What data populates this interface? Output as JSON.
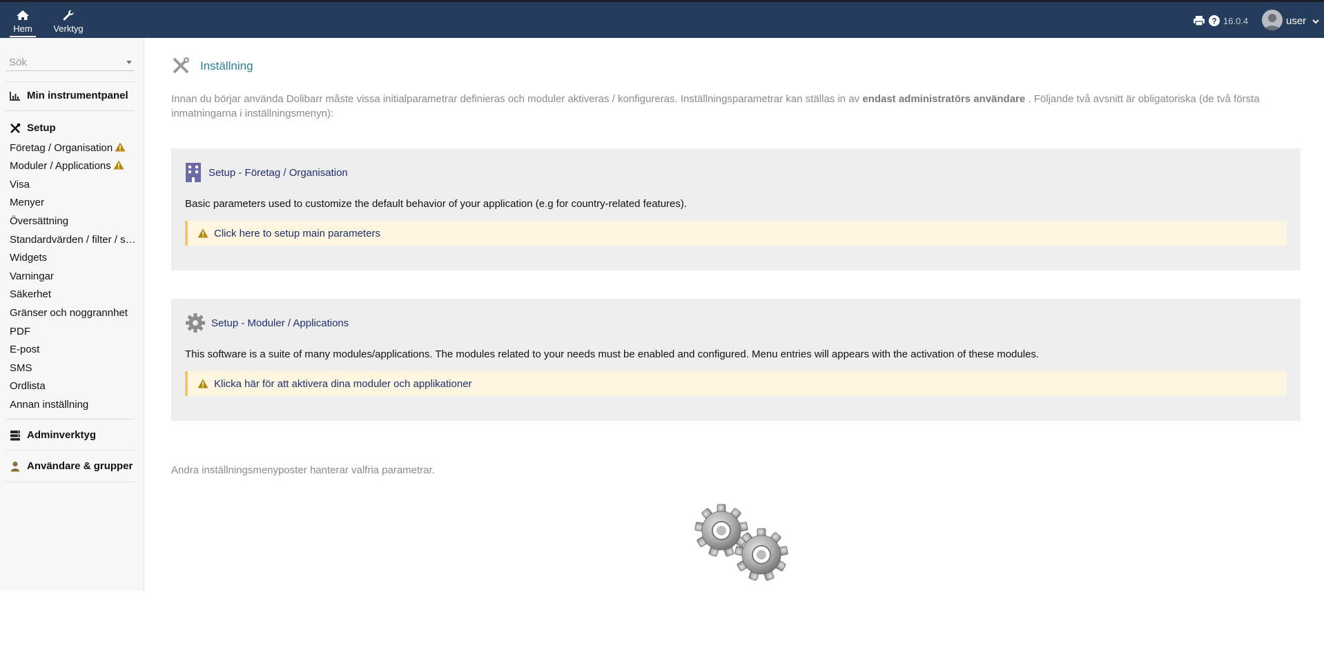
{
  "topbar": {
    "menu": [
      {
        "label": "Hem",
        "icon": "home-icon",
        "active": true
      },
      {
        "label": "Verktyg",
        "icon": "wrench-icon",
        "active": false
      }
    ],
    "version": "16.0.4",
    "user": "user",
    "background_color": "#263c5c"
  },
  "sidebar": {
    "search_placeholder": "Sök",
    "dashboard_label": "Min instrumentpanel",
    "setup_label": "Setup",
    "setup_items": [
      {
        "label": "Företag / Organisation",
        "warning": true
      },
      {
        "label": "Moduler / Applications",
        "warning": true
      },
      {
        "label": "Visa"
      },
      {
        "label": "Menyer"
      },
      {
        "label": "Översättning"
      },
      {
        "label": "Standardvärden / filter / s…"
      },
      {
        "label": "Widgets"
      },
      {
        "label": "Varningar"
      },
      {
        "label": "Säkerhet"
      },
      {
        "label": "Gränser och noggrannhet"
      },
      {
        "label": "PDF"
      },
      {
        "label": "E-post"
      },
      {
        "label": "SMS"
      },
      {
        "label": "Ordlista"
      },
      {
        "label": "Annan inställning"
      }
    ],
    "admin_tools_label": "Adminverktyg",
    "users_groups_label": "Användare & grupper"
  },
  "main": {
    "title": "Inställning",
    "intro_part1": "Innan du börjar använda Dolibarr måste vissa initialparametrar definieras och moduler aktiveras / konfigureras. Inställningsparametrar kan ställas in av",
    "intro_bold": "endast administratörs användare",
    "intro_part2": ". Följande två avsnitt är obligatoriska (de två första inmatningarna i inställningsmenyn):",
    "box_company": {
      "title": "Setup - Företag / Organisation",
      "description": "Basic parameters used to customize the default behavior of your application (e.g for country-related features).",
      "warning_link": "Click here to setup main parameters"
    },
    "box_modules": {
      "title": "Setup - Moduler / Applications",
      "description": "This software is a suite of many modules/applications. The modules related to your needs must be enabled and configured. Menu entries will appears with the activation of these modules.",
      "warning_link": "Klicka här för att aktivera dina moduler och applikationer"
    },
    "other_note": "Andra inställningsmenyposter hanterar valfria parametrar."
  },
  "colors": {
    "title_teal": "#2a8093",
    "link_navy": "#1f2f6b",
    "warning_bg": "#fcf6e0",
    "warning_border": "#f0c56d",
    "warning_icon": "#b7870c"
  }
}
